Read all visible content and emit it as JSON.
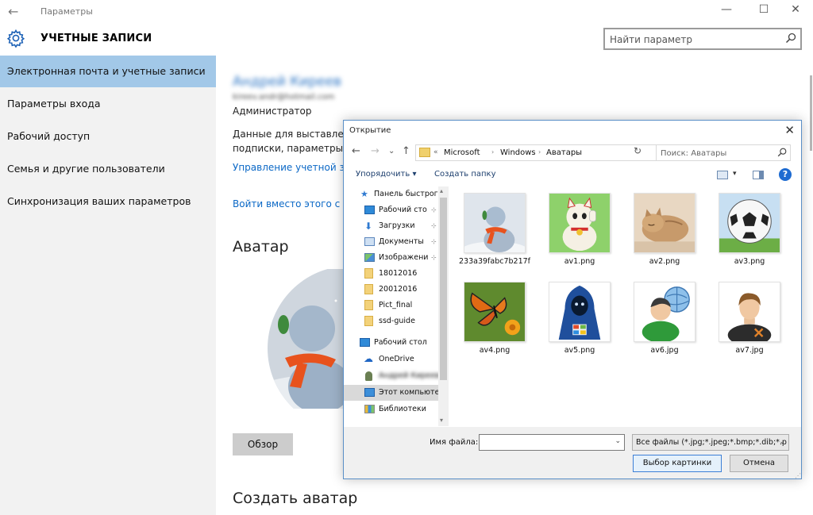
{
  "window": {
    "title": "Параметры",
    "back_glyph": "←",
    "minimize_glyph": "—",
    "maximize_glyph": "☐",
    "close_glyph": "✕"
  },
  "header": {
    "section_title": "УЧЕТНЫЕ ЗАПИСИ",
    "search_placeholder": "Найти параметр"
  },
  "sidebar": {
    "items": [
      {
        "label": "Электронная почта и учетные записи",
        "active": true
      },
      {
        "label": "Параметры входа",
        "active": false
      },
      {
        "label": "Рабочий доступ",
        "active": false
      },
      {
        "label": "Семья и другие пользователи",
        "active": false
      },
      {
        "label": "Синхронизация ваших параметров",
        "active": false
      }
    ]
  },
  "account": {
    "name": "Андрей Киреев",
    "email": "kireev.andr@hotmail.com",
    "role": "Администратор",
    "description_line1": "Данные для выставлени",
    "description_line2": "подписки, параметры б",
    "manage_link": "Управление учетной за",
    "local_link": "Войти вместо этого с ло",
    "avatar_heading": "Аватар",
    "browse_button": "Обзор",
    "create_avatar_heading": "Создать аватар"
  },
  "dialog": {
    "title": "Открытие",
    "close_glyph": "✕",
    "nav_back": "←",
    "nav_forward": "→",
    "nav_recent": "⌄",
    "nav_up": "↑",
    "breadcrumb_prefix": "«",
    "breadcrumb": [
      "Microsoft",
      "Windows",
      "Аватары"
    ],
    "crumb_sep": "›",
    "address_dropdown": "⌄",
    "refresh_glyph": "↻",
    "search_placeholder": "Поиск: Аватары",
    "organize_label": "Упорядочить ▾",
    "new_folder_label": "Создать папку",
    "view_dropdown": "▾",
    "help_glyph": "?",
    "tree": [
      {
        "label": "Панель быстрого",
        "icon": "star-icon"
      },
      {
        "label": "Рабочий сто",
        "icon": "desktop-icon",
        "pinned": true
      },
      {
        "label": "Загрузки",
        "icon": "download-icon",
        "pinned": true
      },
      {
        "label": "Документы",
        "icon": "documents-icon",
        "pinned": true
      },
      {
        "label": "Изображени",
        "icon": "pictures-icon",
        "pinned": true
      },
      {
        "label": "18012016",
        "icon": "folder-icon"
      },
      {
        "label": "20012016",
        "icon": "folder-icon"
      },
      {
        "label": "Pict_final",
        "icon": "folder-icon"
      },
      {
        "label": "ssd-guide",
        "icon": "folder-icon"
      },
      {
        "label": "Рабочий стол",
        "icon": "desktop-icon"
      },
      {
        "label": "OneDrive",
        "icon": "cloud-icon"
      },
      {
        "label": "Андрей Киреев",
        "icon": "user-icon"
      },
      {
        "label": "Этот компьютер",
        "icon": "computer-icon",
        "selected": true
      },
      {
        "label": "Библиотеки",
        "icon": "library-icon"
      }
    ],
    "pin_glyph": "⊹",
    "scroll_up": "▴",
    "scroll_down": "▾",
    "files": [
      {
        "name": "233a39fabc7b217f",
        "kind": "snowman"
      },
      {
        "name": "av1.png",
        "kind": "lucky-cat"
      },
      {
        "name": "av2.png",
        "kind": "kitten"
      },
      {
        "name": "av3.png",
        "kind": "soccer-ball"
      },
      {
        "name": "av4.png",
        "kind": "butterfly"
      },
      {
        "name": "av5.png",
        "kind": "hooded-figure"
      },
      {
        "name": "av6.jpg",
        "kind": "user-globe"
      },
      {
        "name": "av7.jpg",
        "kind": "user-tools"
      }
    ],
    "file_name_label": "Имя файла:",
    "file_name_value": "",
    "file_type": "Все файлы (*.jpg;*.jpeg;*.bmp;*.dib;*.p",
    "dropdown_glyph": "⌄",
    "ok_button": "Выбор картинки",
    "cancel_button": "Отмена",
    "resize_grip": "⋰"
  },
  "colors": {
    "accent": "#0b68c6",
    "sidebar_active": "#a2c8e8",
    "sidebar_bg": "#f2f2f2",
    "dialog_border": "#5a8fc7"
  }
}
